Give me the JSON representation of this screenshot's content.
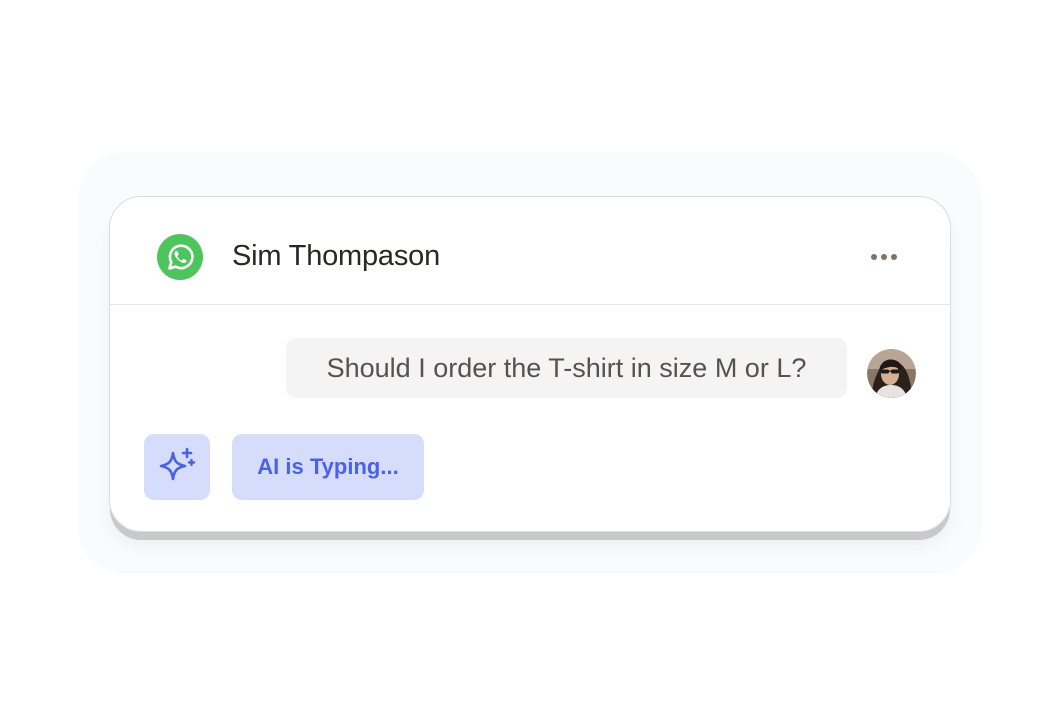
{
  "header": {
    "contact_name": "Sim Thompason",
    "channel_icon": "whatsapp-icon",
    "more_icon": "more-horizontal-icon"
  },
  "messages": [
    {
      "sender": "user",
      "text": "Should I order the T-shirt in size M or L?",
      "avatar_icon": "user-avatar"
    }
  ],
  "assistant": {
    "icon": "sparkle-icon",
    "status_text": "AI is Typing..."
  },
  "colors": {
    "whatsapp_green": "#4dc45c",
    "ai_accent": "#4a62e6",
    "ai_background": "#d6dcfb",
    "bubble_background": "#f3f4f3"
  }
}
